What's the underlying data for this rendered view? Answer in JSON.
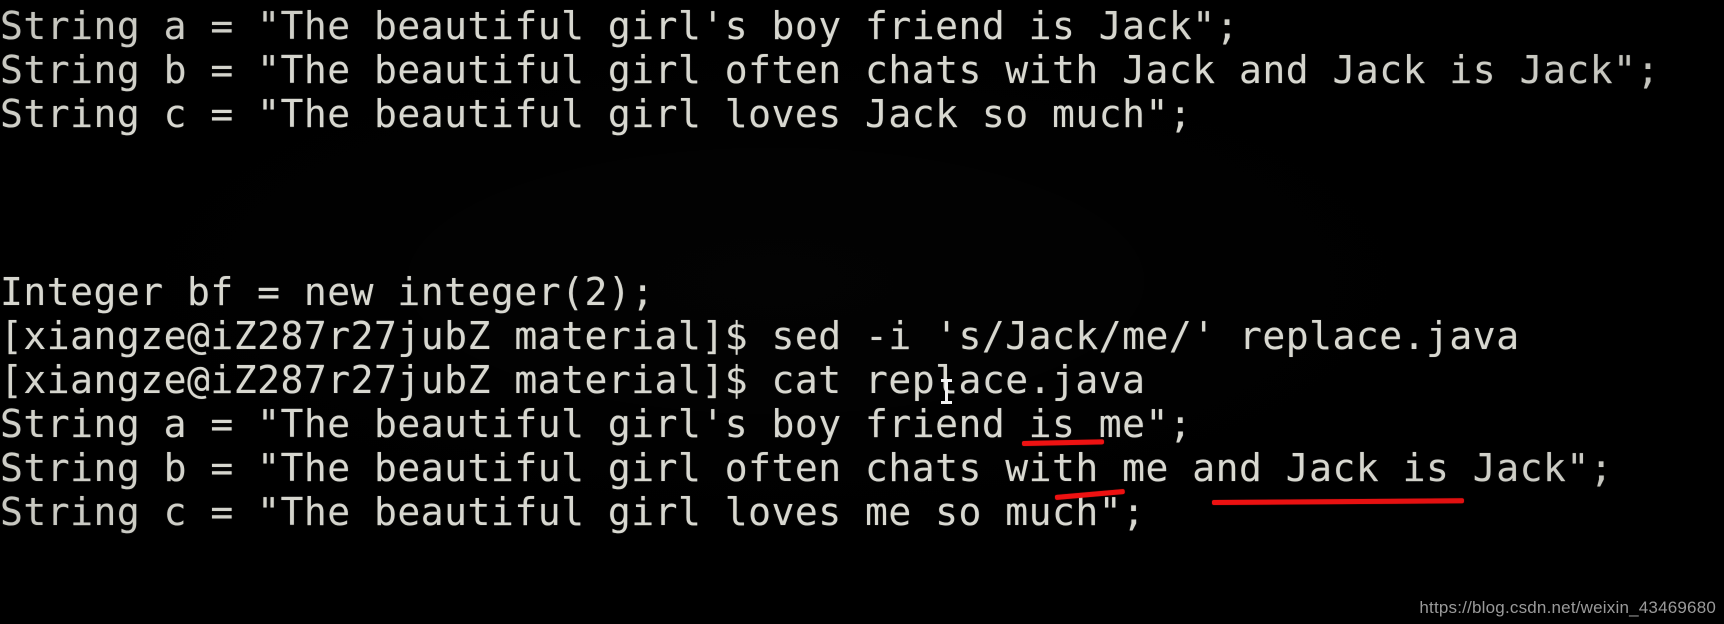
{
  "terminal": {
    "background_color": "#000000",
    "text_color": "#d8d8d0",
    "annotation_color": "#ee1111",
    "prompt_user": "xiangze",
    "prompt_host": "iZ287r27jubZ",
    "prompt_dir": "material",
    "cursor_icon": "text-ibeam-cursor",
    "top_block": [
      "String a = \"The beautiful girl's boy friend is Jack\";",
      "String b = \"The beautiful girl often chats with Jack and Jack is Jack\";",
      "String c = \"The beautiful girl loves Jack so much\";"
    ],
    "middle_block": [
      "Integer bf = new integer(2);",
      "[xiangze@iZ287r27jubZ material]$ sed -i 's/Jack/me/' replace.java",
      "[xiangze@iZ287r27jubZ material]$ cat replace.java"
    ],
    "output_block": [
      "String a = \"The beautiful girl's boy friend is me\";",
      "String b = \"The beautiful girl often chats with me and Jack is Jack\";",
      "String c = \"The beautiful girl loves me so much\";"
    ],
    "commands": {
      "sed": "sed -i 's/Jack/me/' replace.java",
      "cat": "cat replace.java"
    },
    "annotations": [
      {
        "name": "underline-me-line-a",
        "target": "me\";",
        "color": "#ee1111"
      },
      {
        "name": "underline-me-line-b",
        "target": "me",
        "color": "#ee1111"
      },
      {
        "name": "underline-jack-is-jack-line-b",
        "target": "Jack is Jack",
        "color": "#ee1111"
      }
    ]
  },
  "watermark": {
    "text": "https://blog.csdn.net/weixin_43469680"
  }
}
